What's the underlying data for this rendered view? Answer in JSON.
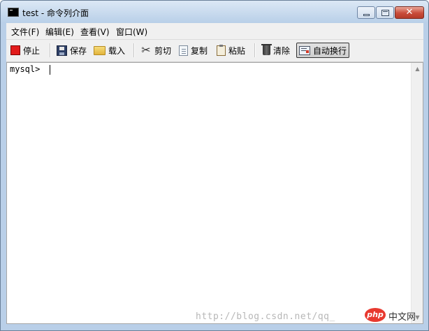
{
  "window": {
    "title": "test - 命令列介面"
  },
  "caption_buttons": {
    "close": "✕"
  },
  "menu": [
    {
      "label": "文件(F)"
    },
    {
      "label": "编辑(E)"
    },
    {
      "label": "查看(V)"
    },
    {
      "label": "窗口(W)"
    }
  ],
  "toolbar": {
    "stop": "停止",
    "save": "保存",
    "load": "载入",
    "cut": "剪切",
    "copy": "复制",
    "paste": "粘贴",
    "clear": "清除",
    "word_wrap": "自动换行"
  },
  "console": {
    "prompt": "mysql>"
  },
  "scrollbar": {
    "up": "▲",
    "down": "▼"
  },
  "watermark": {
    "text": "http://blog.csdn.net/qq_",
    "badge": "php",
    "badge_cn": "中文网"
  },
  "colors": {
    "stop_icon": "#e21b1b",
    "titlebar": "#b9cfe8",
    "close_button": "#c94c3a"
  }
}
